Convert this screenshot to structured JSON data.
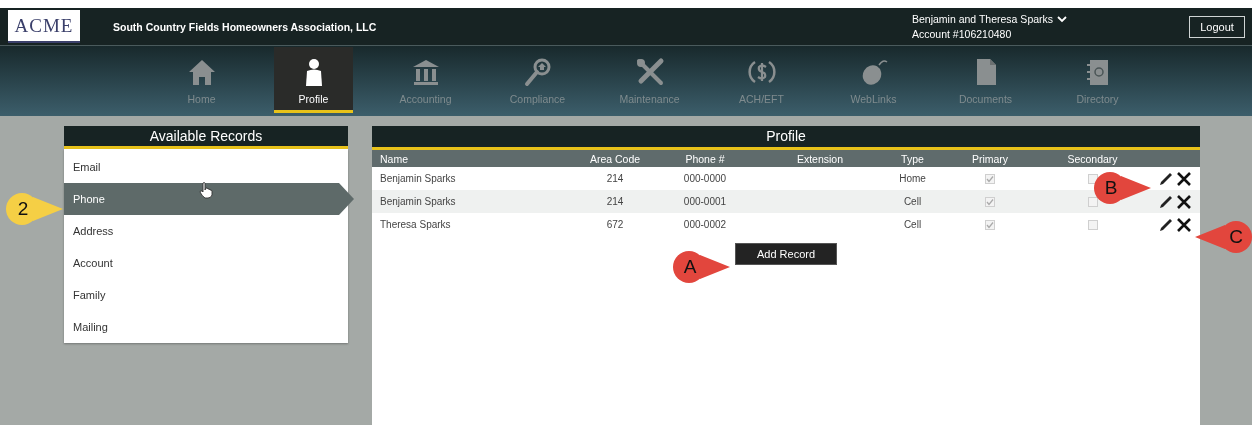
{
  "header": {
    "logo": "ACME",
    "title": "South Country Fields Homeowners Association, LLC",
    "user": "Benjamin and Theresa Sparks",
    "account": "Account #106210480",
    "logout": "Logout"
  },
  "nav": [
    {
      "label": "Home",
      "selected": false
    },
    {
      "label": "Profile",
      "selected": true
    },
    {
      "label": "Accounting",
      "selected": false
    },
    {
      "label": "Compliance",
      "selected": false
    },
    {
      "label": "Maintenance",
      "selected": false
    },
    {
      "label": "ACH/EFT",
      "selected": false
    },
    {
      "label": "WebLinks",
      "selected": false
    },
    {
      "label": "Documents",
      "selected": false
    },
    {
      "label": "Directory",
      "selected": false
    }
  ],
  "records": {
    "title": "Available Records",
    "items": [
      {
        "label": "Email",
        "selected": false
      },
      {
        "label": "Phone",
        "selected": true
      },
      {
        "label": "Address",
        "selected": false
      },
      {
        "label": "Account",
        "selected": false
      },
      {
        "label": "Family",
        "selected": false
      },
      {
        "label": "Mailing",
        "selected": false
      }
    ]
  },
  "profile": {
    "title": "Profile",
    "columns": [
      "Name",
      "Area Code",
      "Phone #",
      "Extension",
      "Type",
      "Primary",
      "Secondary"
    ],
    "rows": [
      {
        "name": "Benjamin Sparks",
        "area_code": "214",
        "phone": "000-0000",
        "type": "Home",
        "primary": true,
        "secondary": false
      },
      {
        "name": "Benjamin Sparks",
        "area_code": "214",
        "phone": "000-0001",
        "type": "Cell",
        "primary": true,
        "secondary": false
      },
      {
        "name": "Theresa Sparks",
        "area_code": "672",
        "phone": "000-0002",
        "type": "Cell",
        "primary": true,
        "secondary": false
      }
    ],
    "add_button": "Add Record"
  },
  "callouts": [
    {
      "label": "2",
      "color": "#f5cf45",
      "kind": "right-pointer"
    },
    {
      "label": "A",
      "color": "#e2463d",
      "kind": "right-pointer"
    },
    {
      "label": "B",
      "color": "#e2463d",
      "kind": "right-pointer"
    },
    {
      "label": "C",
      "color": "#e2463d",
      "kind": "left-pointer"
    }
  ]
}
